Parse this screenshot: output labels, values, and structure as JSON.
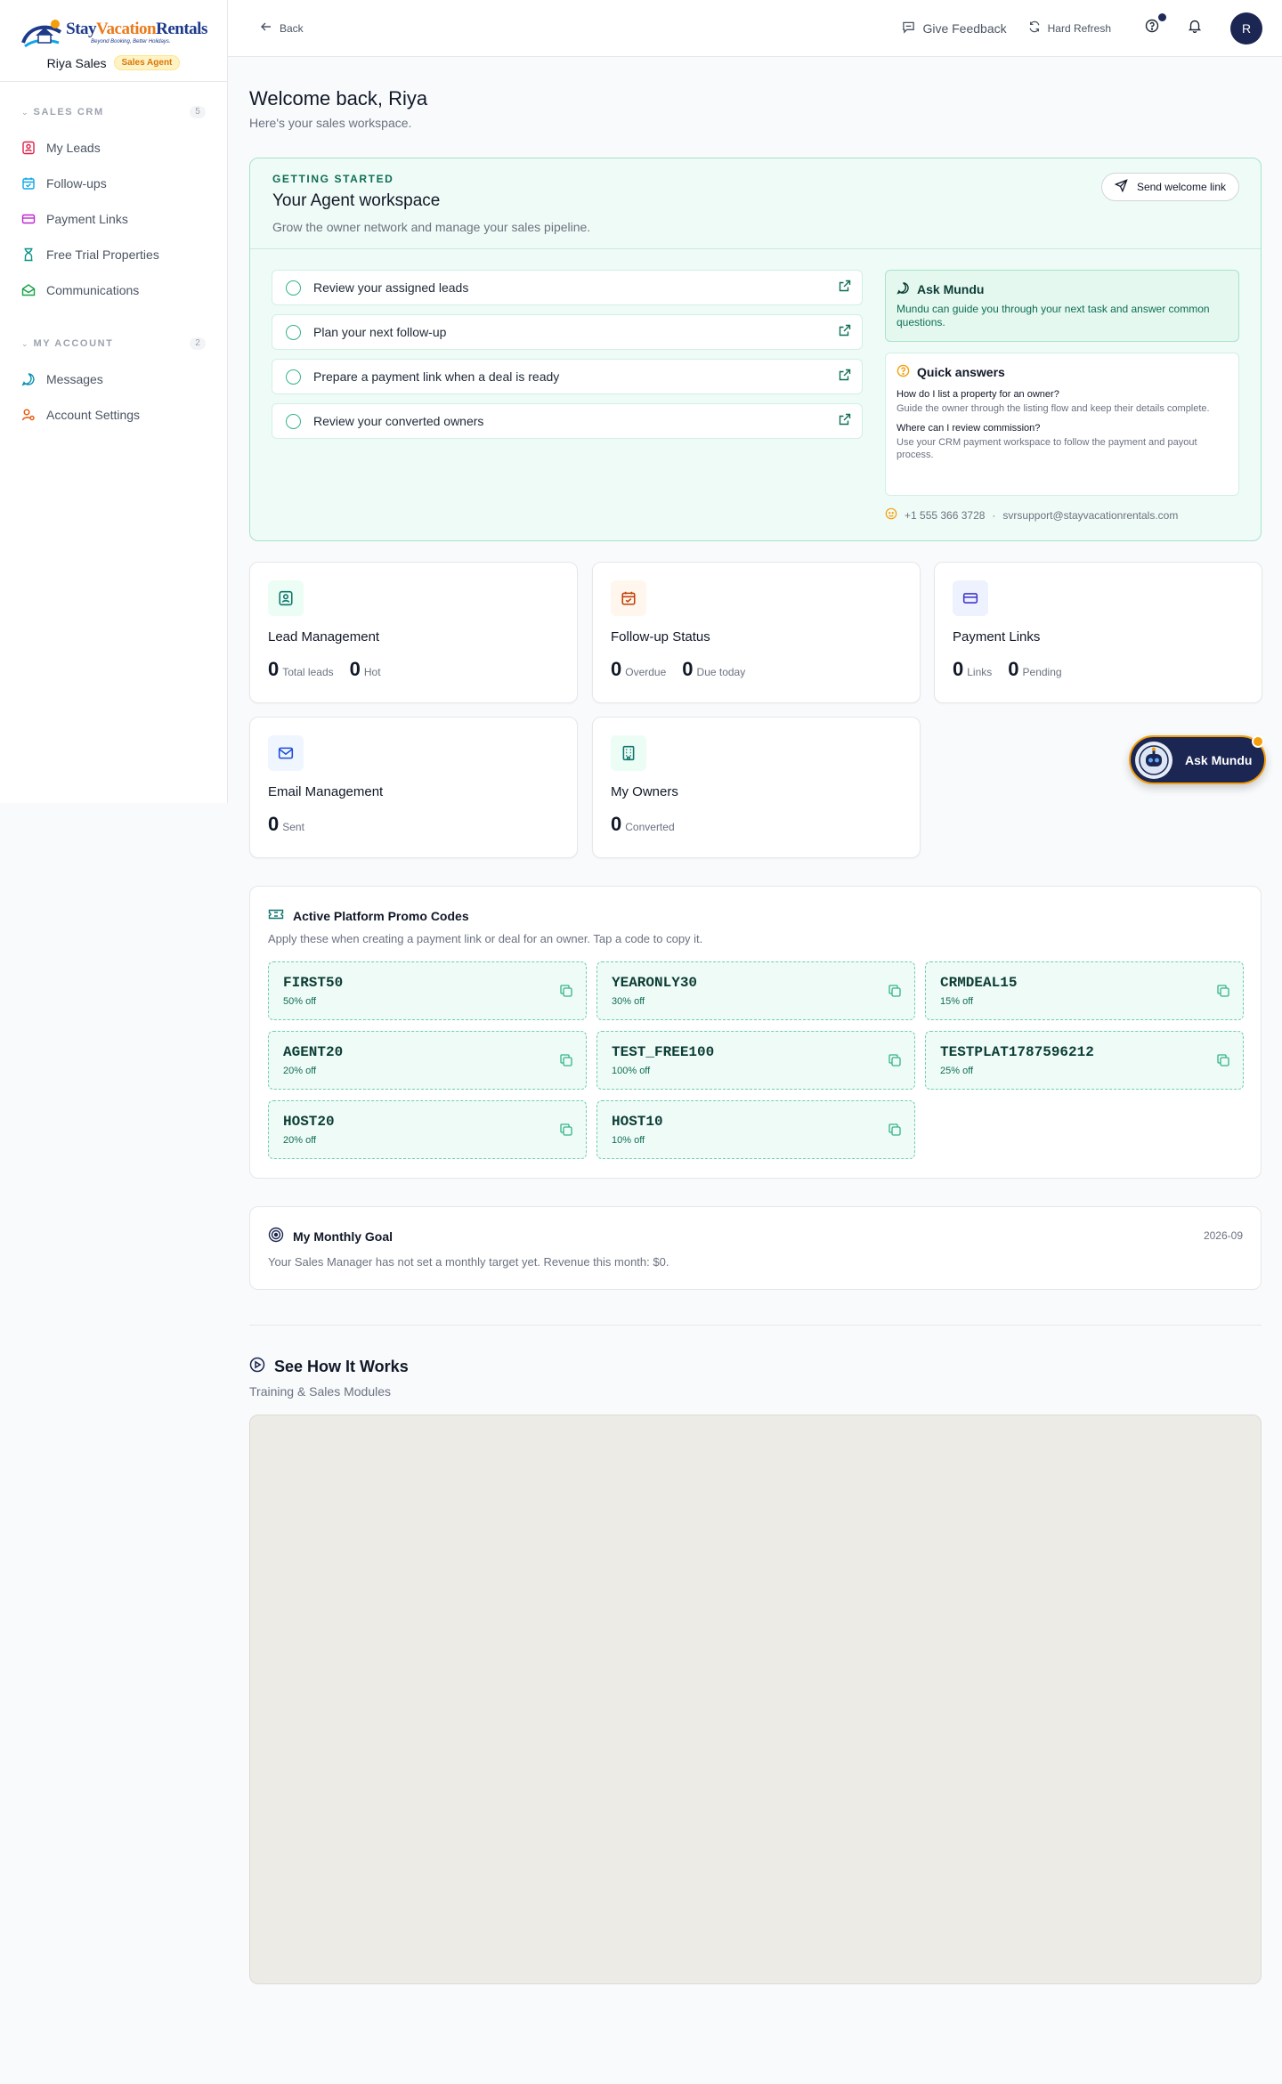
{
  "brand": {
    "logo_word_1": "Stay",
    "logo_word_2": "Vacation",
    "logo_word_3": "Rentals",
    "logo_tagline": "Beyond Booking, Better Holidays.",
    "user_name": "Riya Sales",
    "user_role": "Sales Agent"
  },
  "sidebar": {
    "sections": [
      {
        "title": "SALES CRM",
        "count": "5",
        "items": [
          {
            "label": "My Leads",
            "icon": "contact-card-icon",
            "color": "#e11d48"
          },
          {
            "label": "Follow-ups",
            "icon": "calendar-check-icon",
            "color": "#0ea5e9"
          },
          {
            "label": "Payment Links",
            "icon": "credit-card-icon",
            "color": "#c026d3"
          },
          {
            "label": "Free Trial Properties",
            "icon": "hourglass-icon",
            "color": "#0d9488"
          },
          {
            "label": "Communications",
            "icon": "mail-open-icon",
            "color": "#16a34a"
          }
        ]
      },
      {
        "title": "MY ACCOUNT",
        "count": "2",
        "items": [
          {
            "label": "Messages",
            "icon": "message-circle-icon",
            "color": "#0891b2"
          },
          {
            "label": "Account Settings",
            "icon": "user-cog-icon",
            "color": "#ea580c"
          }
        ]
      }
    ]
  },
  "topbar": {
    "back_label": "Back",
    "feedback_label": "Give Feedback",
    "refresh_label": "Hard Refresh",
    "avatar_initial": "R"
  },
  "welcome": {
    "title": "Welcome back, Riya",
    "subtitle": "Here's your sales workspace."
  },
  "getting_started": {
    "eyebrow": "GETTING STARTED",
    "title": "Your Agent workspace",
    "subtitle": "Grow the owner network and manage your sales pipeline.",
    "send_button": "Send welcome link",
    "tasks": [
      "Review your assigned leads",
      "Plan your next follow-up",
      "Prepare a payment link when a deal is ready",
      "Review your converted owners"
    ],
    "ask": {
      "title": "Ask Mundu",
      "body": "Mundu can guide you through your next task and answer common questions."
    },
    "quick_answers": {
      "title": "Quick answers",
      "q1": "How do I list a property for an owner?",
      "a1": "Guide the owner through the listing flow and keep their details complete.",
      "q2": "Where can I review commission?",
      "a2": "Use your CRM payment workspace to follow the payment and payout process."
    },
    "phone": "+1 555 366 3728",
    "separator": "·",
    "email": "svrsupport@stayvacationrentals.com"
  },
  "stats": [
    {
      "title": "Lead Management",
      "icon": "contact-card-icon",
      "bg": "#ecfdf5",
      "color": "#0f766e",
      "values": [
        {
          "num": "0",
          "unit": "Total leads"
        },
        {
          "num": "0",
          "unit": "Hot"
        }
      ]
    },
    {
      "title": "Follow-up Status",
      "icon": "calendar-check-icon",
      "bg": "#fff7ed",
      "color": "#c2410c",
      "values": [
        {
          "num": "0",
          "unit": "Overdue"
        },
        {
          "num": "0",
          "unit": "Due today"
        }
      ]
    },
    {
      "title": "Payment Links",
      "icon": "credit-card-icon",
      "bg": "#eef2ff",
      "color": "#4338ca",
      "values": [
        {
          "num": "0",
          "unit": "Links"
        },
        {
          "num": "0",
          "unit": "Pending"
        }
      ]
    },
    {
      "title": "Email Management",
      "icon": "mail-icon",
      "bg": "#eff6ff",
      "color": "#1d4ed8",
      "values": [
        {
          "num": "0",
          "unit": "Sent"
        }
      ]
    },
    {
      "title": "My Owners",
      "icon": "building-icon",
      "bg": "#ecfdf5",
      "color": "#0f766e",
      "values": [
        {
          "num": "0",
          "unit": "Converted"
        }
      ]
    }
  ],
  "fab": {
    "label": "Ask Mundu"
  },
  "promo": {
    "title": "Active Platform Promo Codes",
    "subtitle": "Apply these when creating a payment link or deal for an owner. Tap a code to copy it.",
    "codes": [
      {
        "code": "FIRST50",
        "desc": "50% off"
      },
      {
        "code": "YEARONLY30",
        "desc": "30% off"
      },
      {
        "code": "CRMDEAL15",
        "desc": "15% off"
      },
      {
        "code": "AGENT20",
        "desc": "20% off"
      },
      {
        "code": "TEST_FREE100",
        "desc": "100% off"
      },
      {
        "code": "TESTPLAT1787596212",
        "desc": "25% off"
      },
      {
        "code": "HOST20",
        "desc": "20% off"
      },
      {
        "code": "HOST10",
        "desc": "10% off"
      }
    ]
  },
  "goal": {
    "title": "My Monthly Goal",
    "date": "2026-09",
    "text": "Your Sales Manager has not set a monthly target yet. Revenue this month: $0."
  },
  "how": {
    "title": "See How It Works",
    "subtitle": "Training & Sales Modules"
  }
}
